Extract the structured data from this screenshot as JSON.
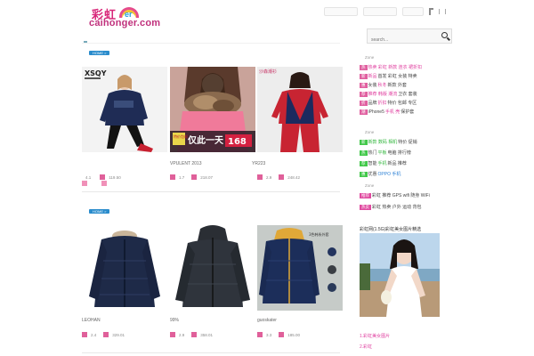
{
  "header": {
    "logo_cn": "彩虹",
    "logo_er": "er",
    "logo_domain": "caihonger.com"
  },
  "search": {
    "placeholder": "search..."
  },
  "sections": [
    {
      "tag": "HOME >",
      "products": [
        {
          "brand": "XSQY",
          "title": "",
          "v1": "4.1",
          "v2": "119.50"
        },
        {
          "title": "",
          "banner": "特价包邮",
          "banner_big": "仅此一天",
          "price": "168",
          "v1": "1.7",
          "v2": "218.07"
        },
        {
          "corner": "沙森潮衫",
          "title": "",
          "v1": "2.9",
          "v2": "248.42"
        }
      ],
      "titles_row": [
        "VPULENT  2013",
        "YR223"
      ]
    },
    {
      "tag": "HOME >",
      "products": [
        {
          "title": "LEOHAN",
          "v1": "2.4",
          "v2": "329.01"
        },
        {
          "title": "99%",
          "v1": "2.9",
          "v2": "358.01"
        },
        {
          "title": "guoskater",
          "corner": "3色韩系外套",
          "v1": "3.3",
          "v2": "185.00"
        }
      ]
    }
  ],
  "sidebar": {
    "zone_labels": [
      "Zone",
      "Zone",
      "Zone"
    ],
    "group1": [
      {
        "tag": "热",
        "tag_color": "pink",
        "parts": [
          [
            "hl-pink",
            "热卖 彩虹 新款 连衣 裙折扣"
          ]
        ]
      },
      {
        "tag": "新",
        "tag_color": "pink",
        "parts": [
          [
            "hl-pink",
            "新品"
          ],
          [
            "",
            " 首发 彩虹 女装 特卖"
          ]
        ]
      },
      {
        "tag": "惠",
        "tag_color": "pink",
        "parts": [
          [
            "",
            "女装 "
          ],
          [
            "hl-pink",
            "秋冬"
          ],
          [
            "",
            " 新款 外套"
          ]
        ]
      },
      {
        "tag": "荐",
        "tag_color": "pink",
        "parts": [
          [
            "hl-pink",
            "推荐 韩版 潮流"
          ],
          [
            "",
            " 卫衣 套装"
          ]
        ]
      },
      {
        "tag": "折",
        "tag_color": "pink",
        "parts": [
          [
            "",
            "品牌 "
          ],
          [
            "hl-pink",
            "折扣"
          ],
          [
            "",
            " 特价 包邮 专区"
          ]
        ]
      },
      {
        "tag": "潮",
        "tag_color": "pink",
        "parts": [
          [
            "",
            "iPhone5"
          ],
          [
            "hl-pink",
            " 手机 壳"
          ],
          [
            "",
            " 保护套"
          ]
        ]
      }
    ],
    "group2": [
      {
        "tag": "新",
        "tag_color": "green",
        "parts": [
          [
            "hl-green",
            "新款 数码 相机"
          ],
          [
            "",
            " 特价 促销"
          ]
        ]
      },
      {
        "tag": "热",
        "tag_color": "green",
        "parts": [
          [
            "",
            "热门 "
          ],
          [
            "hl-green",
            "平板"
          ],
          [
            "",
            " 电脑 排行榜"
          ]
        ]
      },
      {
        "tag": "荐",
        "tag_color": "green",
        "parts": [
          [
            "",
            "智能 "
          ],
          [
            "hl-green",
            "手机"
          ],
          [
            "",
            " 新品 推荐"
          ]
        ]
      },
      {
        "tag": "惠",
        "tag_color": "green",
        "parts": [
          [
            "",
            "优惠 "
          ],
          [
            "hl-blue",
            "OPPO 手机"
          ],
          [
            "",
            ""
          ]
        ]
      }
    ],
    "group3": [
      {
        "tag": "推荐",
        "tag_color": "magenta",
        "parts": [
          [
            "",
            "彩虹 推荐 GPS wifi 随身 WiFi"
          ]
        ]
      },
      {
        "tag": "热卖",
        "tag_color": "magenta",
        "parts": [
          [
            "",
            "彩虹 热卖 户外 运动 背包"
          ]
        ]
      }
    ],
    "promo_title": "彩虹网(1.5G)彩虹美女图片精选",
    "bottom_links": [
      "1.彩虹美女图片",
      "2.彩虹"
    ]
  }
}
